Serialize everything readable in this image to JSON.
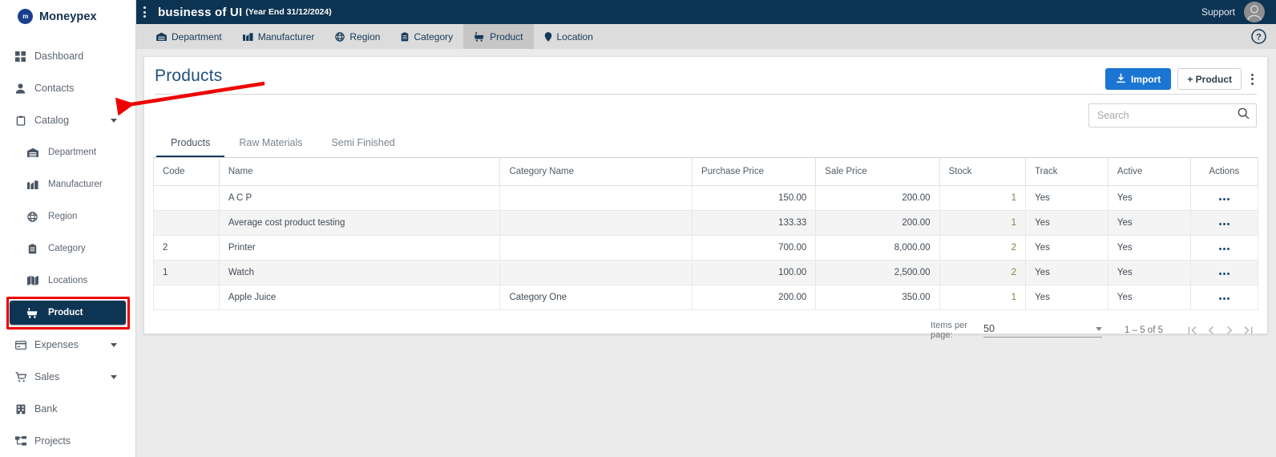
{
  "brand": {
    "name": "Moneypex",
    "logo_icon": "moneypex-logo-icon"
  },
  "sidebar": {
    "items": [
      {
        "label": "Dashboard",
        "icon": "grid-icon",
        "level": "top",
        "chevron": false
      },
      {
        "label": "Contacts",
        "icon": "person-icon",
        "level": "top",
        "chevron": false
      },
      {
        "label": "Catalog",
        "icon": "clipboard-icon",
        "level": "top",
        "chevron": true
      },
      {
        "label": "Department",
        "icon": "warehouse-icon",
        "level": "sub",
        "chevron": false
      },
      {
        "label": "Manufacturer",
        "icon": "factory-icon",
        "level": "sub",
        "chevron": false
      },
      {
        "label": "Region",
        "icon": "globe-icon",
        "level": "sub",
        "chevron": false
      },
      {
        "label": "Category",
        "icon": "clipboard-icon",
        "level": "sub",
        "chevron": false
      },
      {
        "label": "Locations",
        "icon": "map-icon",
        "level": "sub",
        "chevron": false
      },
      {
        "label": "Product",
        "icon": "product-cart-icon",
        "level": "sub-active",
        "chevron": false
      },
      {
        "label": "Expenses",
        "icon": "card-icon",
        "level": "top",
        "chevron": true
      },
      {
        "label": "Sales",
        "icon": "cart-icon",
        "level": "top",
        "chevron": true
      },
      {
        "label": "Bank",
        "icon": "bank-icon",
        "level": "top",
        "chevron": false
      },
      {
        "label": "Projects",
        "icon": "projects-icon",
        "level": "top",
        "chevron": false
      }
    ]
  },
  "topbar": {
    "menu_icon": "kebab-menu-icon",
    "business_title": "business of UI",
    "year_end": "(Year End 31/12/2024)",
    "support_label": "Support",
    "avatar_icon": "user-avatar-icon"
  },
  "navtabs": {
    "items": [
      {
        "label": "Department",
        "icon": "warehouse-icon",
        "active": false
      },
      {
        "label": "Manufacturer",
        "icon": "factory-icon",
        "active": false
      },
      {
        "label": "Region",
        "icon": "globe-icon",
        "active": false
      },
      {
        "label": "Category",
        "icon": "clipboard-icon",
        "active": false
      },
      {
        "label": "Product",
        "icon": "product-cart-icon",
        "active": true
      },
      {
        "label": "Location",
        "icon": "location-pin-icon",
        "active": false
      }
    ],
    "help_icon": "help-circle-icon"
  },
  "page": {
    "title": "Products",
    "import_label": "Import",
    "import_icon": "download-icon",
    "add_product_label": "+ Product",
    "more_icon": "kebab-menu-icon",
    "accent_blue": "#1a76d2",
    "header_navy": "#0d3352"
  },
  "search": {
    "placeholder": "Search",
    "value": "",
    "icon": "search-icon"
  },
  "subtabs": [
    {
      "label": "Products",
      "active": true
    },
    {
      "label": "Raw Materials",
      "active": false
    },
    {
      "label": "Semi Finished",
      "active": false
    }
  ],
  "table": {
    "columns": [
      "Code",
      "Name",
      "Category Name",
      "Purchase Price",
      "Sale Price",
      "Stock",
      "Track",
      "Active",
      "Actions"
    ],
    "rows": [
      {
        "code": "",
        "name": "A C P",
        "category": "",
        "purchase_price": "150.00",
        "sale_price": "200.00",
        "stock": "1",
        "track": "Yes",
        "active": "Yes",
        "actions_icon": "row-actions-icon"
      },
      {
        "code": "",
        "name": "Average cost product testing",
        "category": "",
        "purchase_price": "133.33",
        "sale_price": "200.00",
        "stock": "1",
        "track": "Yes",
        "active": "Yes",
        "actions_icon": "row-actions-icon"
      },
      {
        "code": "2",
        "name": "Printer",
        "category": "",
        "purchase_price": "700.00",
        "sale_price": "8,000.00",
        "stock": "2",
        "track": "Yes",
        "active": "Yes",
        "actions_icon": "row-actions-icon"
      },
      {
        "code": "1",
        "name": "Watch",
        "category": "",
        "purchase_price": "100.00",
        "sale_price": "2,500.00",
        "stock": "2",
        "track": "Yes",
        "active": "Yes",
        "actions_icon": "row-actions-icon"
      },
      {
        "code": "",
        "name": "Apple Juice",
        "category": "Category One",
        "purchase_price": "200.00",
        "sale_price": "350.00",
        "stock": "1",
        "track": "Yes",
        "active": "Yes",
        "actions_icon": "row-actions-icon"
      }
    ]
  },
  "pagination": {
    "items_per_page_label": "Items per page:",
    "items_per_page_value": "50",
    "range_label": "1 – 5 of 5",
    "first_icon": "first-page-icon",
    "prev_icon": "prev-page-icon",
    "next_icon": "next-page-icon",
    "last_icon": "last-page-icon"
  },
  "annotations": {
    "arrow_color": "#ee0000",
    "highlight_color": "#ef0000"
  }
}
